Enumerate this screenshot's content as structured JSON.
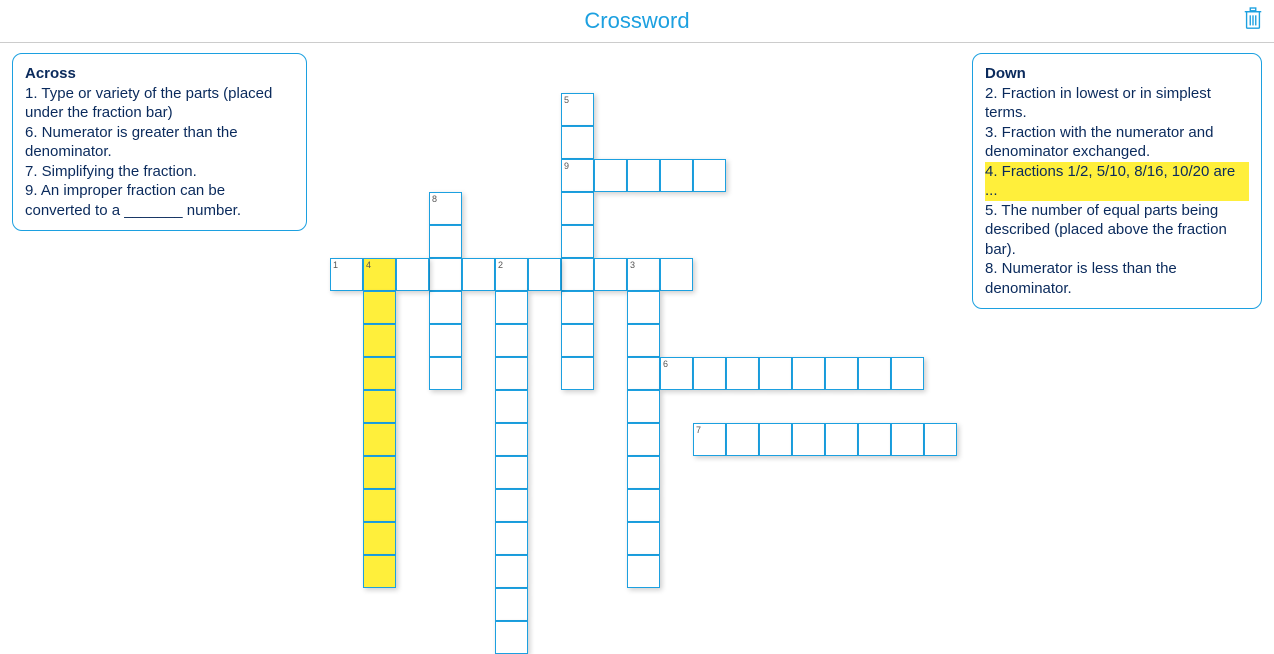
{
  "title": "Crossword",
  "across_title": "Across",
  "down_title": "Down",
  "across": {
    "c1": "1. Type or variety of the parts (placed under the fraction bar)",
    "c6": "6. Numerator is greater than the denominator.",
    "c7": "7. Simplifying the fraction.",
    "c9": "9. An improper fraction can be converted to a _______ number."
  },
  "down": {
    "c2": "2. Fraction in lowest or in simplest terms.",
    "c3": "3. Fraction with the numerator and denominator exchanged.",
    "c4": "4. Fractions 1/2, 5/10, 8/16, 10/20 are ...",
    "c5": "5. The number of equal parts being described (placed above the fraction bar).",
    "c8": "8. Numerator is less than the denominator."
  },
  "highlighted_clue": "down.c4",
  "grid": {
    "cell_size": 33,
    "numbers": {
      "5": [
        7,
        0
      ],
      "9": [
        7,
        2
      ],
      "8": [
        3,
        3
      ],
      "1": [
        0,
        5
      ],
      "4": [
        1,
        5
      ],
      "2": [
        5,
        5
      ],
      "3": [
        9,
        5
      ],
      "6": [
        10,
        8
      ],
      "7": [
        11,
        10
      ]
    }
  }
}
